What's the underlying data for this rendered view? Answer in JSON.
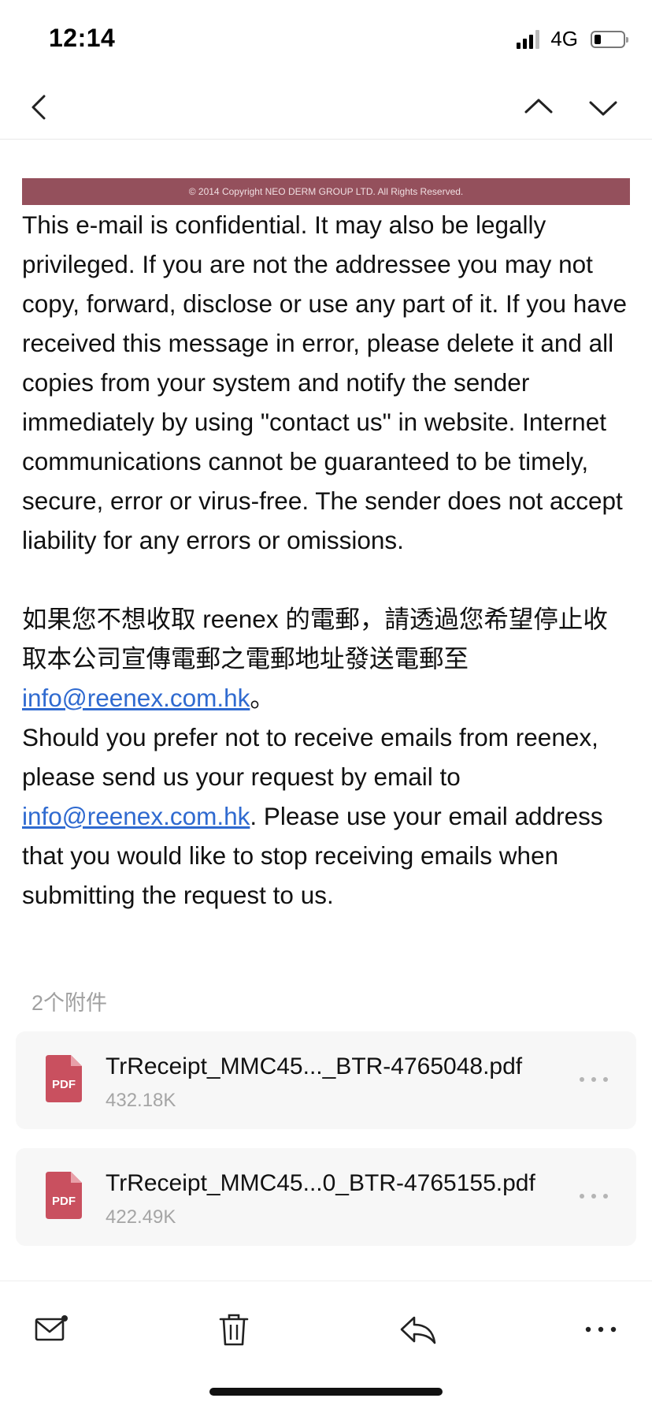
{
  "status_bar": {
    "time": "12:14",
    "network": "4G"
  },
  "nav": {
    "back_icon": "chevron-left-icon",
    "prev_icon": "chevron-up-icon",
    "next_icon": "chevron-down-icon"
  },
  "email": {
    "banner_text": "© 2014 Copyright NEO DERM GROUP LTD. All Rights Reserved.",
    "disclaimer": "This e-mail is confidential. It may also be legally privileged. If you are not the addressee you may not copy, forward, disclose or use any part of it. If you have received this message in error, please delete it and all copies from your system and notify the sender immediately by using \"contact us\" in website. Internet communications cannot be guaranteed to be timely, secure, error or virus-free. The sender does not accept liability for any errors or omissions.",
    "chinese_text": "如果您不想收取 reenex 的電郵，請透過您希望停止收取本公司宣傳電郵之電郵地址發送電郵至",
    "chinese_link": "info@reenex.com.hk",
    "chinese_end": "。",
    "english_text_1": "Should you prefer not to receive emails from reenex, please send us your request by email to",
    "english_link": "info@reenex.com.hk",
    "english_text_2": ". Please use your email address that you would like to stop receiving emails when submitting the request to us."
  },
  "attachments": {
    "label": "2个附件",
    "items": [
      {
        "icon": "pdf-file-icon",
        "icon_text": "PDF",
        "name": "TrReceipt_MMC45..._BTR-4765048.pdf",
        "size": "432.18K"
      },
      {
        "icon": "pdf-file-icon",
        "icon_text": "PDF",
        "name": "TrReceipt_MMC45...0_BTR-4765155.pdf",
        "size": "422.49K"
      }
    ]
  },
  "toolbar": {
    "items": [
      {
        "icon": "mark-unread-icon"
      },
      {
        "icon": "trash-icon"
      },
      {
        "icon": "reply-icon"
      },
      {
        "icon": "more-icon"
      }
    ]
  },
  "colors": {
    "banner": "#94505c",
    "link": "#2f6ad0",
    "pdf_icon": "#c9505f"
  }
}
